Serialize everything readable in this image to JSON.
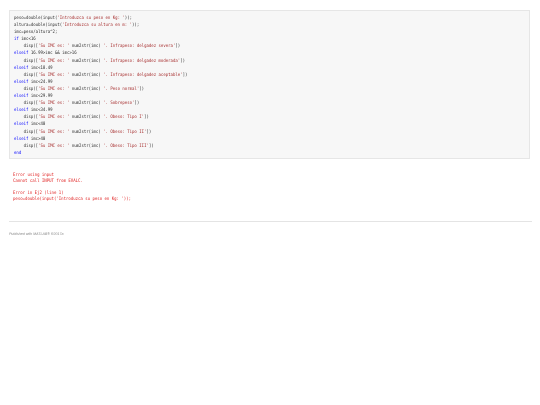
{
  "code": {
    "lines": [
      [
        {
          "t": "peso=double(input(",
          "c": "p"
        },
        {
          "t": "'Introduzca su peso en Kg: '",
          "c": "s"
        },
        {
          "t": "));",
          "c": "p"
        }
      ],
      [
        {
          "t": "altura=double(input(",
          "c": "p"
        },
        {
          "t": "'Introduzca su altura en m: '",
          "c": "s"
        },
        {
          "t": "));",
          "c": "p"
        }
      ],
      [
        {
          "t": "imc=peso/altura^2;",
          "c": "p"
        }
      ],
      [
        {
          "t": "if",
          "c": "k"
        },
        {
          "t": " imc<16",
          "c": "p"
        }
      ],
      [
        {
          "t": "    disp([",
          "c": "p"
        },
        {
          "t": "'Su IMC es: '",
          "c": "s"
        },
        {
          "t": " num2str(imc) ",
          "c": "p"
        },
        {
          "t": "'. Infrapeso: delgadez severa'",
          "c": "s"
        },
        {
          "t": "])",
          "c": "p"
        }
      ],
      [
        {
          "t": "elseif",
          "c": "k"
        },
        {
          "t": " 16.99>imc && imc>16",
          "c": "p"
        }
      ],
      [
        {
          "t": "    disp([",
          "c": "p"
        },
        {
          "t": "'Su IMC es: '",
          "c": "s"
        },
        {
          "t": " num2str(imc) ",
          "c": "p"
        },
        {
          "t": "'. Infrapeso: delgadez moderada'",
          "c": "s"
        },
        {
          "t": "])",
          "c": "p"
        }
      ],
      [
        {
          "t": "elseif",
          "c": "k"
        },
        {
          "t": " imc<18.49",
          "c": "p"
        }
      ],
      [
        {
          "t": "    disp([",
          "c": "p"
        },
        {
          "t": "'Su IMC es: '",
          "c": "s"
        },
        {
          "t": " num2str(imc) ",
          "c": "p"
        },
        {
          "t": "'. Infrapeso: delgadez aceptable'",
          "c": "s"
        },
        {
          "t": "])",
          "c": "p"
        }
      ],
      [
        {
          "t": "elseif",
          "c": "k"
        },
        {
          "t": " imc<24.99",
          "c": "p"
        }
      ],
      [
        {
          "t": "    disp([",
          "c": "p"
        },
        {
          "t": "'Su IMC es: '",
          "c": "s"
        },
        {
          "t": " num2str(imc) ",
          "c": "p"
        },
        {
          "t": "'. Peso normal'",
          "c": "s"
        },
        {
          "t": "])",
          "c": "p"
        }
      ],
      [
        {
          "t": "elseif",
          "c": "k"
        },
        {
          "t": " imc<29.99",
          "c": "p"
        }
      ],
      [
        {
          "t": "    disp([",
          "c": "p"
        },
        {
          "t": "'Su IMC es: '",
          "c": "s"
        },
        {
          "t": " num2str(imc) ",
          "c": "p"
        },
        {
          "t": "'. Sobrepeso'",
          "c": "s"
        },
        {
          "t": "])",
          "c": "p"
        }
      ],
      [
        {
          "t": "elseif",
          "c": "k"
        },
        {
          "t": " imc<34.99",
          "c": "p"
        }
      ],
      [
        {
          "t": "    disp([",
          "c": "p"
        },
        {
          "t": "'Su IMC es: '",
          "c": "s"
        },
        {
          "t": " num2str(imc) ",
          "c": "p"
        },
        {
          "t": "'. Obeso: Tipo I'",
          "c": "s"
        },
        {
          "t": "])",
          "c": "p"
        }
      ],
      [
        {
          "t": "elseif",
          "c": "k"
        },
        {
          "t": " imc<40",
          "c": "p"
        }
      ],
      [
        {
          "t": "    disp([",
          "c": "p"
        },
        {
          "t": "'Su IMC es: '",
          "c": "s"
        },
        {
          "t": " num2str(imc) ",
          "c": "p"
        },
        {
          "t": "'. Obeso: Tipo II'",
          "c": "s"
        },
        {
          "t": "])",
          "c": "p"
        }
      ],
      [
        {
          "t": "elseif",
          "c": "k"
        },
        {
          "t": " imc>40",
          "c": "p"
        }
      ],
      [
        {
          "t": "    disp([",
          "c": "p"
        },
        {
          "t": "'Su IMC es: '",
          "c": "s"
        },
        {
          "t": " num2str(imc) ",
          "c": "p"
        },
        {
          "t": "'. Obeso: Tipo III'",
          "c": "s"
        },
        {
          "t": "])",
          "c": "p"
        }
      ],
      [
        {
          "t": "end",
          "c": "k"
        }
      ]
    ]
  },
  "output": {
    "error_lines": [
      "Error using input",
      "Cannot call INPUT from EVALC.",
      "",
      "Error in Ej2 (line 1)",
      "peso=double(input('Introduzca su peso en Kg: '));"
    ]
  },
  "footer": {
    "text": "Published with MATLAB® R2017a"
  },
  "colors": {
    "code_background": "#f7f7f7",
    "string": "#a52a2a",
    "keyword": "#0000ff",
    "error": "#e02020",
    "footer": "#8a8a8a"
  }
}
